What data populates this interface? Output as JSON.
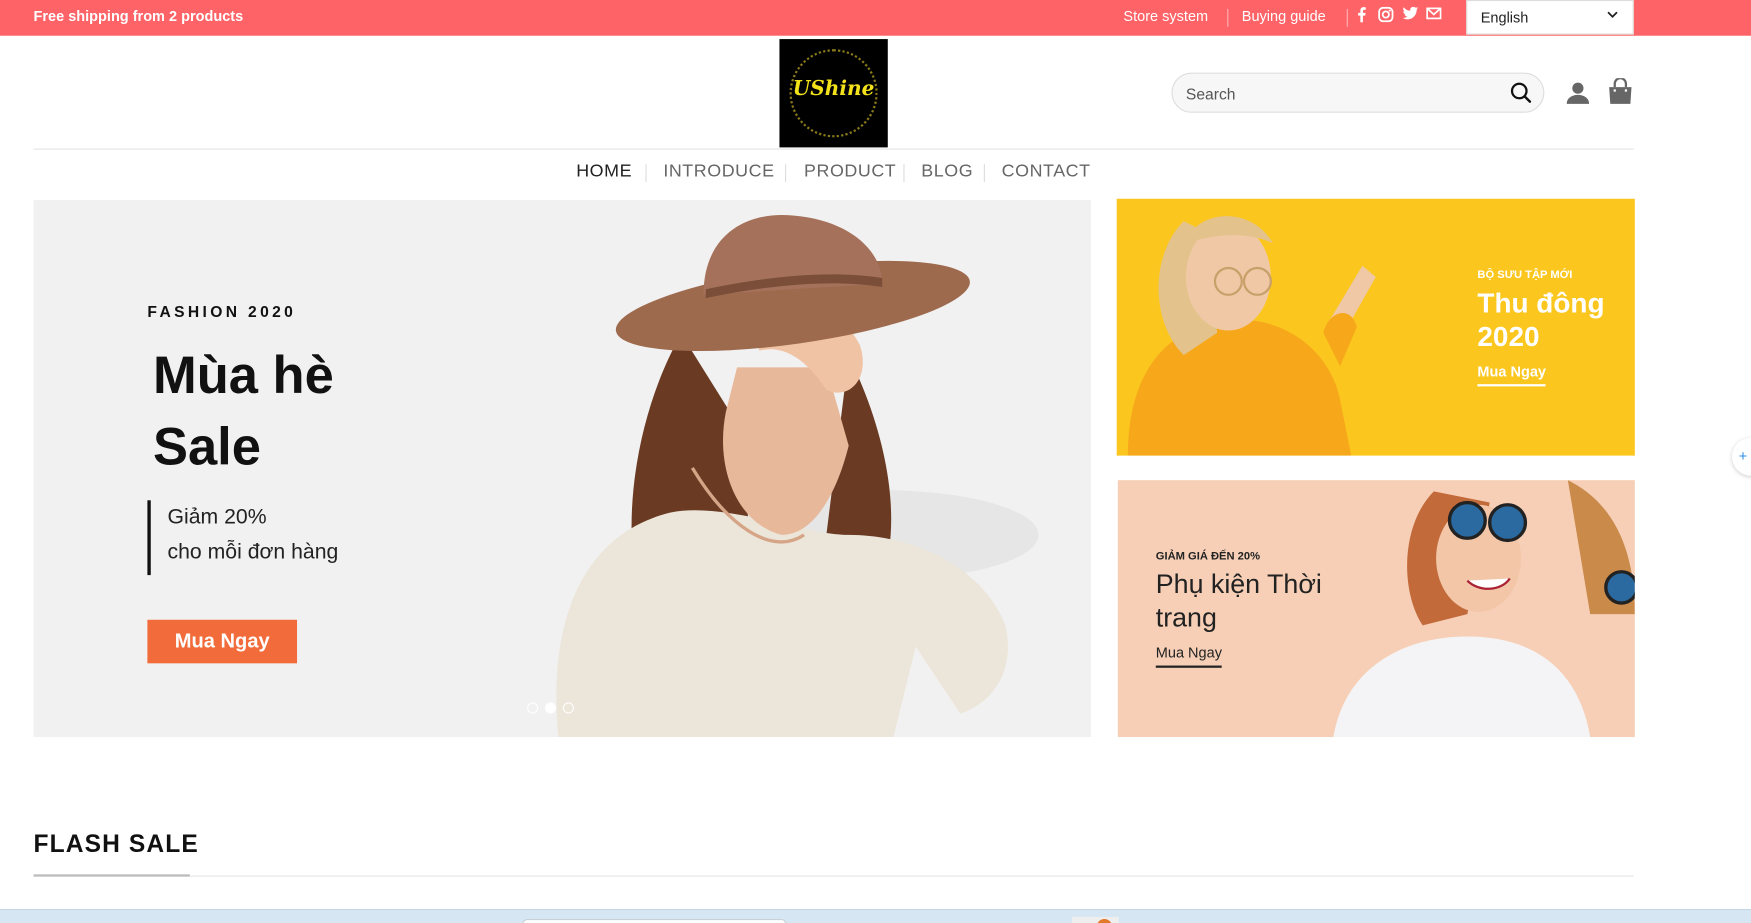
{
  "topbar": {
    "promo": "Free shipping from 2 products",
    "store_system": "Store system",
    "buying_guide": "Buying guide",
    "social": [
      "facebook-icon",
      "instagram-icon",
      "twitter-icon",
      "mail-icon"
    ],
    "language": "English",
    "bg_color": "#fd6367"
  },
  "header": {
    "logo_text": "UShine",
    "search_placeholder": "Search"
  },
  "nav": {
    "items": [
      "HOME",
      "INTRODUCE",
      "PRODUCT",
      "BLOG",
      "CONTACT"
    ],
    "active": "HOME"
  },
  "hero": {
    "eyebrow": "FASHION 2020",
    "title_line1": "Mùa hè",
    "title_line2": "Sale",
    "quote_line1": "Giảm 20%",
    "quote_line2": "cho mỗi đơn hàng",
    "cta": "Mua Ngay",
    "cta_color": "#f26b3a",
    "slides": 3,
    "active_slide": 2
  },
  "banner_top": {
    "kicker": "BỘ SƯU TẬP MỚI",
    "head": "Thu đông 2020",
    "cta": "Mua Ngay",
    "bg_color": "#fbc61e"
  },
  "banner_bottom": {
    "kicker": "GIẢM GIÁ ĐẾN 20%",
    "head": "Phụ kiện Thời trang",
    "cta": "Mua Ngay",
    "bg_color": "#f6cfb6"
  },
  "section": {
    "flash_sale": "FLASH SALE"
  }
}
